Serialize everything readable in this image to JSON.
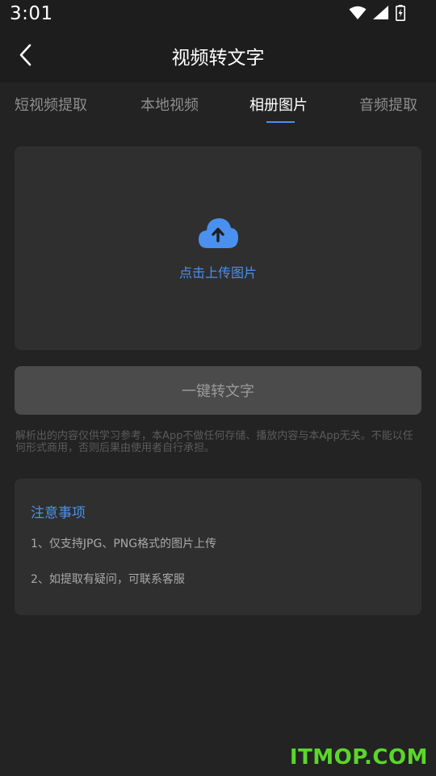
{
  "status_bar": {
    "time": "3:01",
    "icons": [
      "wifi-icon",
      "cellular-signal-icon",
      "battery-charging-icon"
    ]
  },
  "header": {
    "title": "视频转文字",
    "back_icon": "chevron-left-icon"
  },
  "tabs": [
    {
      "label": "短视频提取",
      "active": false
    },
    {
      "label": "本地视频",
      "active": false
    },
    {
      "label": "相册图片",
      "active": true
    },
    {
      "label": "音频提取",
      "active": false
    }
  ],
  "upload": {
    "icon": "cloud-upload-icon",
    "label": "点击上传图片"
  },
  "convert_button": {
    "label": "一键转文字"
  },
  "disclaimer": "解析出的内容仅供学习参考，本App不做任何存储、播放内容与本App无关。不能以任何形式商用，否则后果由使用者自行承担。",
  "notes": {
    "title": "注意事项",
    "items": [
      "1、仅支持JPG、PNG格式的图片上传",
      "2、如提取有疑问，可联系客服"
    ]
  },
  "watermark": "ITMOP.COM",
  "colors": {
    "accent": "#4a90ee",
    "background": "#232323",
    "card": "#2f2f2f",
    "watermark": "#5bd62b"
  }
}
